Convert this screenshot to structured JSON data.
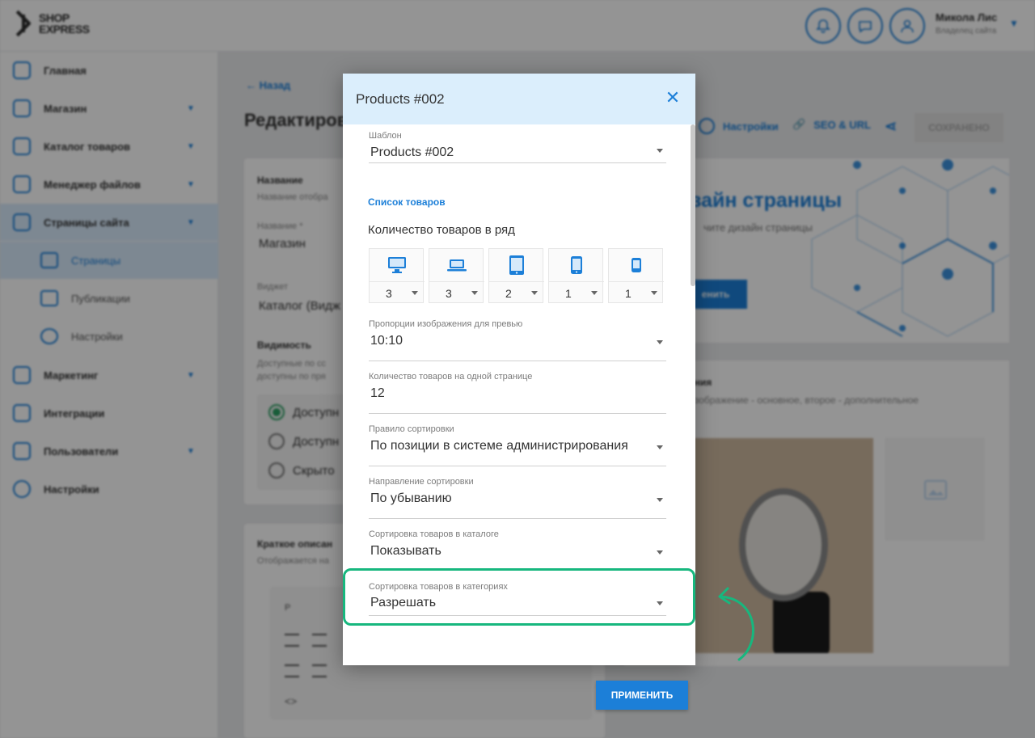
{
  "topbar": {
    "logo_line1": "SHOP",
    "logo_line2": "EXPRESS",
    "icons": [
      "bell-icon",
      "chat-icon",
      "user-icon"
    ],
    "user_name": "Микола Лис",
    "user_role": "Владелец сайта"
  },
  "sidebar": {
    "items": [
      {
        "label": "Главная",
        "icon": "home-icon"
      },
      {
        "label": "Магазин",
        "icon": "cart-icon"
      },
      {
        "label": "Каталог товаров",
        "icon": "book-icon"
      },
      {
        "label": "Менеджер файлов",
        "icon": "folder-icon"
      },
      {
        "label": "Страницы сайта",
        "icon": "pages-icon"
      },
      {
        "label": "Маркетинг",
        "icon": "marketing-icon"
      },
      {
        "label": "Интеграции",
        "icon": "megaphone-icon"
      },
      {
        "label": "Пользователи",
        "icon": "users-icon"
      },
      {
        "label": "Настройки",
        "icon": "gear-icon"
      }
    ],
    "subitems": [
      {
        "label": "Страницы"
      },
      {
        "label": "Публикации"
      },
      {
        "label": "Настройки"
      }
    ]
  },
  "main": {
    "back": "Назад",
    "title": "Редактиров",
    "name_section": "Название",
    "name_hint": "Название отобра",
    "name_field_label": "Название *",
    "name_field_value": "Магазин",
    "widget_label": "Виджет",
    "widget_value": "Каталог (Видж",
    "visibility_title": "Видимость",
    "visibility_hint1": "Доступные по сс",
    "visibility_hint2": "доступны по пря",
    "radio_options": [
      "Доступн",
      "Доступн",
      "Скрыто"
    ],
    "short_desc_title": "Краткое описан",
    "short_desc_hint": "Отображается на",
    "editor_p": "P",
    "settings_link": "Настройки",
    "seo_link": "SEO & URL",
    "saved_button": "СОХРАНЕНО",
    "design_title": "зайн страницы",
    "design_sub": "чите дизайн страницы",
    "design_btn": "енить",
    "images_title": "ения",
    "images_hint": "изображение - основное, второе - дополнительное"
  },
  "modal": {
    "title": "Products #002",
    "template_label": "Шаблон",
    "template_value": "Products #002",
    "section_link": "Список товаров",
    "per_row_title": "Количество товаров в ряд",
    "devices": [
      {
        "icon": "desktop-icon",
        "value": "3"
      },
      {
        "icon": "laptop-icon",
        "value": "3"
      },
      {
        "icon": "tablet-icon",
        "value": "2"
      },
      {
        "icon": "phone-icon",
        "value": "1"
      },
      {
        "icon": "small-phone-icon",
        "value": "1"
      }
    ],
    "fields": [
      {
        "label": "Пропорции изображения для превью",
        "value": "10:10",
        "dropdown": true
      },
      {
        "label": "Количество товаров на одной странице",
        "value": "12",
        "dropdown": false
      },
      {
        "label": "Правило сортировки",
        "value": "По позиции в системе администрирования",
        "dropdown": true
      },
      {
        "label": "Направление сортировки",
        "value": "По убыванию",
        "dropdown": true
      },
      {
        "label": "Сортировка товаров в каталоге",
        "value": "Показывать",
        "dropdown": true
      },
      {
        "label": "Сортировка товаров в категориях",
        "value": "Разрешать",
        "dropdown": true
      }
    ],
    "apply_button": "ПРИМЕНИТЬ"
  },
  "colors": {
    "accent": "#1c7fd8",
    "highlight": "#17b77e",
    "header_bg": "#dbeefc"
  }
}
